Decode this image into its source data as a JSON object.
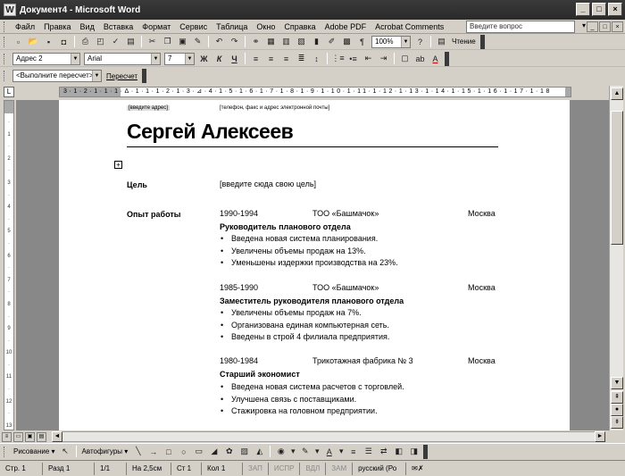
{
  "window": {
    "title": "Документ4 - Microsoft Word",
    "app_icon": "W",
    "controls": [
      "_",
      "□",
      "×"
    ]
  },
  "menu": {
    "items": [
      "Файл",
      "Правка",
      "Вид",
      "Вставка",
      "Формат",
      "Сервис",
      "Таблица",
      "Окно",
      "Справка",
      "Adobe PDF",
      "Acrobat Comments"
    ],
    "help_placeholder": "Введите вопрос",
    "help_arrow": "▾",
    "doc_controls": [
      "_",
      "□",
      "×"
    ]
  },
  "standard_toolbar": {
    "icons": [
      "new-doc-icon",
      "open-icon",
      "save-icon",
      "permission-icon",
      "print-icon",
      "print-preview-icon",
      "spelling-icon",
      "research-icon",
      "cut-icon",
      "copy-icon",
      "paste-icon",
      "format-painter-icon",
      "undo-icon",
      "redo-icon",
      "hyperlink-icon",
      "tables-borders-icon",
      "insert-table-icon",
      "insert-excel-icon",
      "columns-icon",
      "drawing-icon",
      "doc-map-icon",
      "show-marks-icon"
    ],
    "glyphs": [
      "▫",
      "📂",
      "▪",
      "◘",
      "⎙",
      "◰",
      "✓",
      "▤",
      "✂",
      "❐",
      "▣",
      "✎",
      "↶",
      "↷",
      "⚭",
      "▦",
      "▥",
      "▧",
      "▮",
      "✐",
      "▩",
      "¶"
    ],
    "zoom": "100%",
    "help_glyph": "?",
    "reading_glyph": "▤",
    "reading_label": "Чтение"
  },
  "formatting_toolbar": {
    "style": "Адрес 2",
    "font": "Arial",
    "size": "7",
    "bold": "Ж",
    "italic": "К",
    "underline": "Ч",
    "align_glyphs": [
      "≡",
      "≡",
      "≡",
      "≣"
    ],
    "line_spacing_glyph": "↕",
    "list_glyphs": [
      "⋮≡",
      "•≡",
      "⇤",
      "⇥"
    ],
    "border_glyph": "▢",
    "highlight_glyph": "ab",
    "font_color_glyph": "A"
  },
  "formula_toolbar": {
    "combo": "<Выполните пересчет>",
    "button": "Пересчет"
  },
  "ruler": {
    "numbers": "3·1·2·1·1·1·Δ·1·1·1·2·1·3·⊿·4·1·5·1·6·1·7·1·8·1·9·1·10·1·11·1·12·1·13·1·14·1·15·1·16·1·17·1·18",
    "corner": "L"
  },
  "vruler_numbers": [
    "·",
    "1",
    "·",
    "2",
    "·",
    "3",
    "·",
    "4",
    "·",
    "5",
    "·",
    "6",
    "·",
    "7",
    "·",
    "8",
    "·",
    "9",
    "·",
    "10",
    "·",
    "11",
    "·",
    "12",
    "·",
    "13",
    "·"
  ],
  "document": {
    "address_placeholder": "[введите адрес]",
    "contact_placeholder": "[телефон, факс и адрес электронной почты]",
    "name": "Сергей Алексеев",
    "table_handle": "+",
    "objective_label": "Цель",
    "objective_text": "[введите сюда свою цель]",
    "experience_label": "Опыт работы",
    "jobs": [
      {
        "years": "1990-1994",
        "company": "ТОО «Башмачок»",
        "city": "Москва",
        "position": "Руководитель планового отдела",
        "bullets": [
          "Введена новая система планирования.",
          "Увеличены объемы продаж на 13%.",
          "Уменьшены издержки производства на 23%."
        ]
      },
      {
        "years": "1985-1990",
        "company": "ТОО «Башмачок»",
        "city": "Москва",
        "position": "Заместитель руководителя планового отдела",
        "bullets": [
          "Увеличены объемы продаж на 7%.",
          "Организована единая компьютерная сеть.",
          "Введены в строй 4 филиала предприятия."
        ]
      },
      {
        "years": "1980-1984",
        "company": "Трикотажная фабрика № 3",
        "city": "Москва",
        "position": "Старший экономист",
        "bullets": [
          "Введена новая система расчетов с торговлей.",
          "Улучшена связь с поставщиками.",
          "Стажировка на головном предприятии."
        ]
      }
    ]
  },
  "scrollbar": {
    "up": "▲",
    "down": "▼",
    "prev_page": "⇞",
    "select_object": "●",
    "next_page": "⇟",
    "left": "◄",
    "right": "►"
  },
  "view_buttons": [
    "≡",
    "▭",
    "▣",
    "▤"
  ],
  "drawing_toolbar": {
    "draw_label": "Рисование ▾",
    "pointer_glyph": "↖",
    "autoshapes_label": "Автофигуры ▾",
    "tool_glyphs": [
      "╲",
      "→",
      "□",
      "○",
      "▭",
      "◢",
      "✿",
      "▨",
      "◭",
      "◉",
      "▾",
      "✎",
      "▾",
      "A",
      "▾",
      "≡",
      "☰",
      "⇄",
      "◧",
      "◨"
    ]
  },
  "status": {
    "page": "Стр. 1",
    "section": "Разд 1",
    "page_of": "1/1",
    "at": "На 2,5см",
    "line": "Ст 1",
    "col": "Кол 1",
    "rec": "ЗАП",
    "trk": "ИСПР",
    "ext": "ВДЛ",
    "ovr": "ЗАМ",
    "lang": "русский (Ро",
    "spell_icon": "✉✗"
  }
}
